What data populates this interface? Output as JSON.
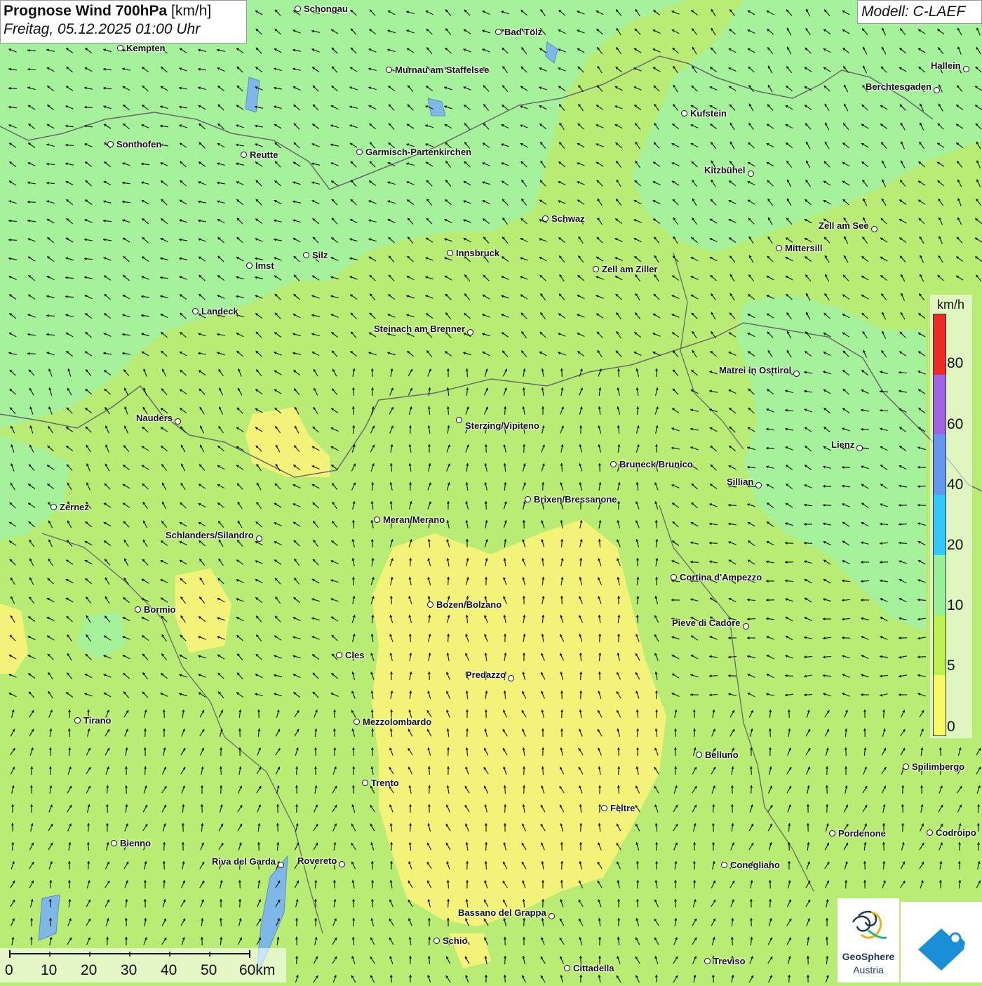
{
  "title": {
    "main": "Prognose Wind 700hPa",
    "unit": "[km/h]",
    "datetime": "Freitag, 05.12.2025 01:00 Uhr"
  },
  "model": "Modell: C-LAEF",
  "legend": {
    "unit": "km/h",
    "labels": [
      "80",
      "60",
      "40",
      "20",
      "10",
      "5",
      "0"
    ],
    "colors": [
      "#ee2a2a",
      "#a064e6",
      "#6496f0",
      "#32c8fa",
      "#96f096",
      "#bef050",
      "#fafa64"
    ]
  },
  "scale_bar": {
    "labels": [
      "0",
      "10",
      "20",
      "30",
      "40",
      "50",
      "60km"
    ]
  },
  "logos": {
    "geosphere_name": "GeoSphere",
    "geosphere_sub": "Austria"
  },
  "cities": [
    {
      "name": "Schongau"
    },
    {
      "name": "Bad Tölz"
    },
    {
      "name": "Kempten"
    },
    {
      "name": "Murnau am Staffelsee"
    },
    {
      "name": "Hallein"
    },
    {
      "name": "Berchtesgaden"
    },
    {
      "name": "Kufstein"
    },
    {
      "name": "Sonthofen"
    },
    {
      "name": "Reutte"
    },
    {
      "name": "Garmisch-Partenkirchen"
    },
    {
      "name": "Kitzbühel"
    },
    {
      "name": "Schwaz"
    },
    {
      "name": "Zell am See"
    },
    {
      "name": "Mittersill"
    },
    {
      "name": "Innsbruck"
    },
    {
      "name": "Silz"
    },
    {
      "name": "Imst"
    },
    {
      "name": "Zell am Ziller"
    },
    {
      "name": "Landeck"
    },
    {
      "name": "Steinach am Brenner"
    },
    {
      "name": "Matrei in Osttirol"
    },
    {
      "name": "Nauders"
    },
    {
      "name": "Sterzing/Vipiteno"
    },
    {
      "name": "Lienz"
    },
    {
      "name": "Bruneck/Brunico"
    },
    {
      "name": "Sillian"
    },
    {
      "name": "Zernez"
    },
    {
      "name": "Brixen/Bressanone"
    },
    {
      "name": "Meran/Merano"
    },
    {
      "name": "Schlanders/Silandro"
    },
    {
      "name": "Cortina d'Ampezzo"
    },
    {
      "name": "Bozen/Bolzano"
    },
    {
      "name": "Bormio"
    },
    {
      "name": "Pieve di Cadore"
    },
    {
      "name": "Cles"
    },
    {
      "name": "Predazzo"
    },
    {
      "name": "Tirano"
    },
    {
      "name": "Mezzolombardo"
    },
    {
      "name": "Belluno"
    },
    {
      "name": "Spilimbergo"
    },
    {
      "name": "Trento"
    },
    {
      "name": "Feltre"
    },
    {
      "name": "Bienno"
    },
    {
      "name": "Pordenone"
    },
    {
      "name": "Codroipo"
    },
    {
      "name": "Riva del Garda"
    },
    {
      "name": "Rovereto"
    },
    {
      "name": "Conegliano"
    },
    {
      "name": "Bassano del Grappa"
    },
    {
      "name": "Schio"
    },
    {
      "name": "Treviso"
    },
    {
      "name": "Cittadella"
    }
  ]
}
